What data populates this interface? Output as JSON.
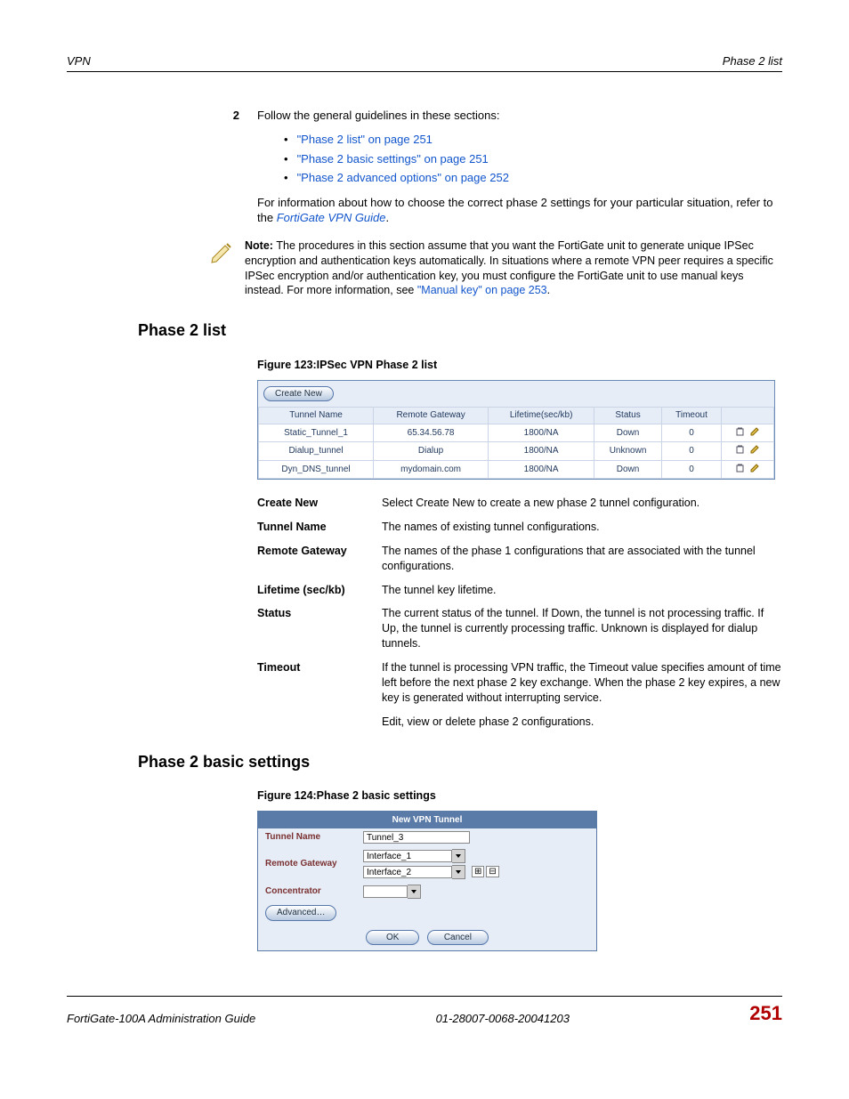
{
  "header": {
    "left": "VPN",
    "right": "Phase 2 list"
  },
  "step": {
    "num": "2",
    "intro": "Follow the general guidelines in these sections:",
    "links": [
      "\"Phase 2 list\" on page 251",
      "\"Phase 2 basic settings\" on page 251",
      "\"Phase 2 advanced options\" on page 252"
    ],
    "after1": "For information about how to choose the correct phase 2 settings for your particular situation, refer to the ",
    "after_link": "FortiGate VPN Guide",
    "after2": "."
  },
  "note": {
    "lead": "Note: ",
    "body1": "The procedures in this section assume that you want the FortiGate unit to generate unique IPSec encryption and authentication keys automatically. In situations where a remote VPN peer requires a specific IPSec encryption and/or authentication key, you must configure the FortiGate unit to use manual keys instead. For more information, see ",
    "body_link": "\"Manual key\" on page 253",
    "body2": "."
  },
  "section1": {
    "title": "Phase 2 list",
    "fig_caption": "Figure 123:IPSec VPN Phase 2 list",
    "create_btn": "Create New",
    "cols": [
      "Tunnel Name",
      "Remote Gateway",
      "Lifetime(sec/kb)",
      "Status",
      "Timeout",
      ""
    ],
    "rows": [
      {
        "name": "Static_Tunnel_1",
        "gw": "65.34.56.78",
        "life": "1800/NA",
        "status": "Down",
        "timeout": "0"
      },
      {
        "name": "Dialup_tunnel",
        "gw": "Dialup",
        "life": "1800/NA",
        "status": "Unknown",
        "timeout": "0"
      },
      {
        "name": "Dyn_DNS_tunnel",
        "gw": "mydomain.com",
        "life": "1800/NA",
        "status": "Down",
        "timeout": "0"
      }
    ],
    "defs": [
      {
        "term": "Create New",
        "desc": "Select Create New to create a new phase 2 tunnel configuration."
      },
      {
        "term": "Tunnel Name",
        "desc": "The names of existing tunnel configurations."
      },
      {
        "term": "Remote Gateway",
        "desc": "The names of the phase 1 configurations that are associated with the tunnel configurations."
      },
      {
        "term": "Lifetime (sec/kb)",
        "desc": "The tunnel key lifetime."
      },
      {
        "term": "Status",
        "desc": "The current status of the tunnel. If Down, the tunnel is not processing traffic. If Up, the tunnel is currently processing traffic. Unknown is displayed for dialup tunnels."
      },
      {
        "term": "Timeout",
        "desc": "If the tunnel is processing VPN traffic, the Timeout value specifies amount of time left before the next phase 2 key exchange. When the phase 2 key expires, a new key is generated without interrupting service."
      },
      {
        "term": "",
        "desc": "Edit, view or delete phase 2 configurations."
      }
    ]
  },
  "section2": {
    "title": "Phase 2 basic settings",
    "fig_caption": "Figure 124:Phase 2 basic settings",
    "form_title": "New VPN Tunnel",
    "labels": {
      "tunnel": "Tunnel Name",
      "gateway": "Remote Gateway",
      "conc": "Concentrator",
      "adv": "Advanced…",
      "ok": "OK",
      "cancel": "Cancel"
    },
    "values": {
      "tunnel": "Tunnel_3",
      "gw1": "Interface_1",
      "gw2": "Interface_2"
    },
    "plus": "⊞",
    "minus": "⊟"
  },
  "footer": {
    "left": "FortiGate-100A Administration Guide",
    "mid": "01-28007-0068-20041203",
    "page": "251"
  }
}
